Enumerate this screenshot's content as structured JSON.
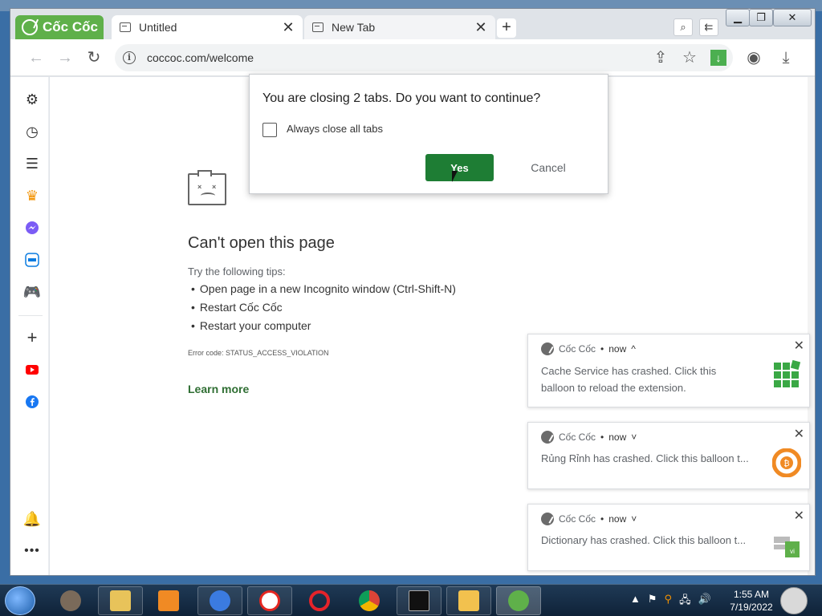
{
  "browser": {
    "brand_label": "Cốc Cốc",
    "tabs": [
      {
        "label": "Untitled",
        "close": "✕"
      },
      {
        "label": "New Tab",
        "close": "✕"
      }
    ],
    "new_tab": "+",
    "url": "coccoc.com/welcome",
    "info_glyph": "i"
  },
  "dialog": {
    "question": "You are closing 2 tabs. Do you want to continue?",
    "checkbox_label": "Always close all tabs",
    "checkbox_checked": false,
    "yes_label": "Yes",
    "cancel_label": "Cancel"
  },
  "error_page": {
    "title": "Can't open this page",
    "tips_heading": "Try the following tips:",
    "tips": [
      "Open page in a new Incognito window (Ctrl-Shift-N)",
      "Restart Cốc Cốc",
      "Restart your computer"
    ],
    "error_code": "Error code: STATUS_ACCESS_VIOLATION",
    "learn_more": "Learn more"
  },
  "notifications": [
    {
      "app": "Cốc Cốc",
      "time": "now",
      "caret": "^",
      "line1": "Cache Service has crashed. Click this",
      "line2": "balloon to reload the extension.",
      "icon": "puzzle-grid-icon"
    },
    {
      "app": "Cốc Cốc",
      "time": "now",
      "caret": "˅",
      "line1": "Rủng Rỉnh has crashed. Click this balloon t...",
      "icon": "coin-icon"
    },
    {
      "app": "Cốc Cốc",
      "time": "now",
      "caret": "˅",
      "line1": "Dictionary has crashed. Click this balloon t...",
      "icon": "dictionary-icon"
    }
  ],
  "taskbar": {
    "time": "1:55 AM",
    "date": "7/19/2022"
  },
  "colors": {
    "brand_green": "#5fb04a",
    "yes_button": "#1e7d34",
    "learn_more": "#2f6e33"
  }
}
